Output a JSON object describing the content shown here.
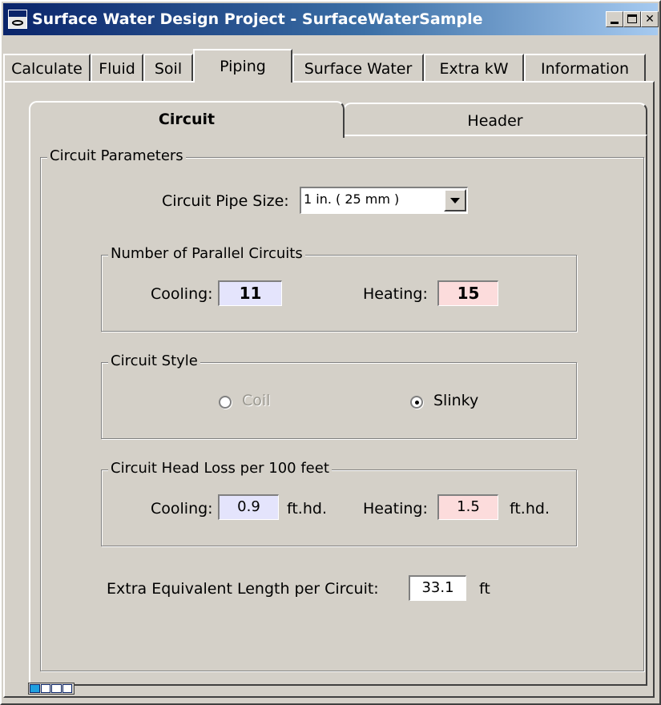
{
  "window": {
    "title": "Surface Water Design Project - SurfaceWaterSample"
  },
  "main_tabs": [
    {
      "label": "Calculate"
    },
    {
      "label": "Fluid"
    },
    {
      "label": "Soil"
    },
    {
      "label": "Piping",
      "active": true
    },
    {
      "label": "Surface Water"
    },
    {
      "label": "Extra kW"
    },
    {
      "label": "Information"
    }
  ],
  "sub_tabs": [
    {
      "label": "Circuit",
      "active": true
    },
    {
      "label": "Header"
    }
  ],
  "circuit_parameters": {
    "legend": "Circuit Parameters",
    "pipe_size_label": "Circuit Pipe Size:",
    "pipe_size_value": "1 in. ( 25 mm )",
    "parallel": {
      "legend": "Number of Parallel Circuits",
      "cooling_label": "Cooling:",
      "cooling_value": "11",
      "heating_label": "Heating:",
      "heating_value": "15"
    },
    "style": {
      "legend": "Circuit Style",
      "coil_label": "Coil",
      "slinky_label": "Slinky",
      "selected": "Slinky"
    },
    "head_loss": {
      "legend": "Circuit Head Loss per 100 feet",
      "cooling_label": "Cooling:",
      "cooling_value": "0.9",
      "cooling_unit": "ft.hd.",
      "heating_label": "Heating:",
      "heating_value": "1.5",
      "heating_unit": "ft.hd."
    },
    "extra_length": {
      "label": "Extra Equivalent Length per Circuit:",
      "value": "33.1",
      "unit": "ft"
    }
  },
  "colors": {
    "titlebar_start": "#0a246a",
    "cooling_field": "#e4e4fc",
    "heating_field": "#fcdcdc"
  },
  "status": {
    "progress_segments_filled": 1,
    "progress_segments_total": 4
  }
}
